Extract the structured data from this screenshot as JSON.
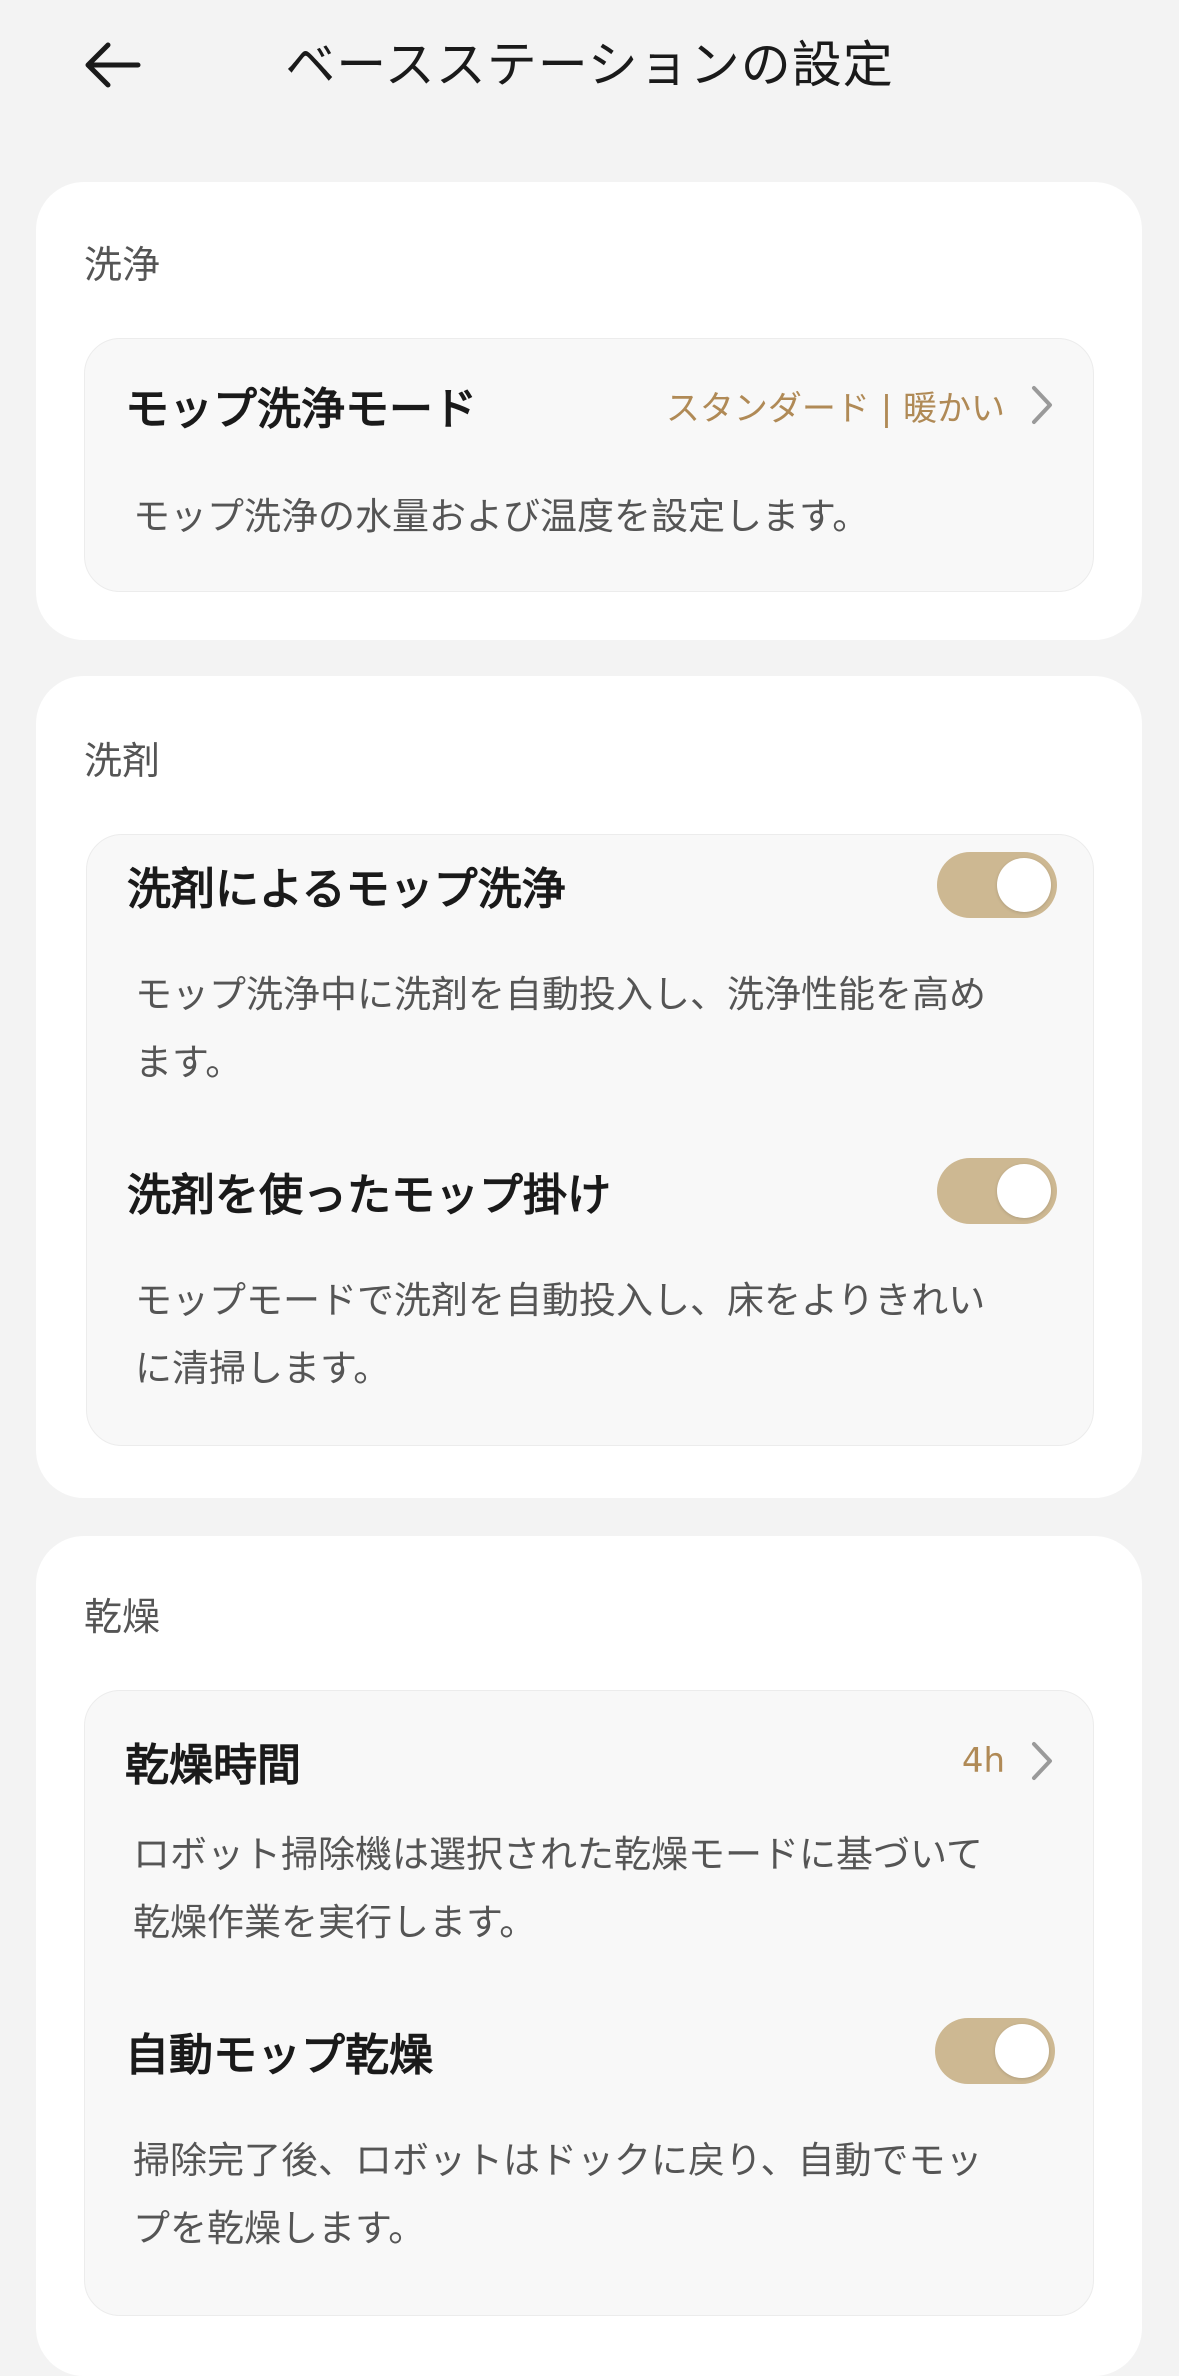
{
  "header": {
    "title": "ベースステーションの設定",
    "back_icon": "arrow-left-icon"
  },
  "sections": [
    {
      "label": "洗浄",
      "items": [
        {
          "title": "モップ洗浄モード",
          "value": "スタンダード | 暖かい",
          "control": "chevron",
          "description": "モップ洗浄の水量および温度を設定します。"
        }
      ]
    },
    {
      "label": "洗剤",
      "items": [
        {
          "title": "洗剤によるモップ洗浄",
          "control": "toggle",
          "enabled": true,
          "description_lines": [
            "モップ洗浄中に洗剤を自動投入し、洗浄性能を高め",
            "ます。"
          ]
        },
        {
          "title": "洗剤を使ったモップ掛け",
          "control": "toggle",
          "enabled": true,
          "description_lines": [
            "モップモードで洗剤を自動投入し、床をよりきれい",
            "に清掃します。"
          ]
        }
      ]
    },
    {
      "label": "乾燥",
      "items": [
        {
          "title": "乾燥時間",
          "value": "4h",
          "control": "chevron",
          "description_lines": [
            "ロボット掃除機は選択された乾燥モードに基づいて",
            "乾燥作業を実行します。"
          ]
        },
        {
          "title": "自動モップ乾燥",
          "control": "toggle",
          "enabled": true,
          "description_lines": [
            "掃除完了後、ロボットはドックに戻り、自動でモッ",
            "プを乾燥します。"
          ]
        }
      ]
    }
  ],
  "colors": {
    "background": "#f3f3f3",
    "card": "#ffffff",
    "item_box": "#f8f8f8",
    "accent": "#b08a56",
    "toggle_on": "#cdb892",
    "text_primary": "#1a1a1a",
    "text_secondary": "#555555"
  }
}
